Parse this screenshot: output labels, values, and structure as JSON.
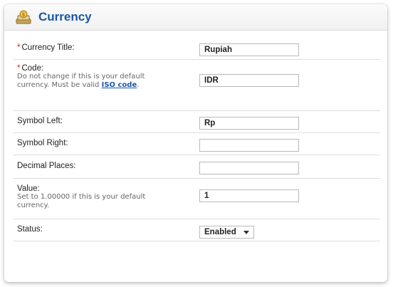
{
  "header": {
    "title": "Currency",
    "icon": "currency-icon"
  },
  "form": {
    "currency_title": {
      "label": "Currency Title:",
      "required_mark": "*",
      "value": "Rupiah"
    },
    "code": {
      "label": "Code:",
      "required_mark": "*",
      "help": "Do not change if this is your default currency. Must be valid",
      "help_link": "ISO code",
      "help_suffix": ".",
      "value": "IDR"
    },
    "symbol_left": {
      "label": "Symbol Left:",
      "value": "Rp"
    },
    "symbol_right": {
      "label": "Symbol Right:",
      "value": ""
    },
    "decimal_places": {
      "label": "Decimal Places:",
      "value": ""
    },
    "value": {
      "label": "Value:",
      "help": "Set to 1.00000 if this is your default currency.",
      "value": "1"
    },
    "status": {
      "label": "Status:",
      "selected": "Enabled"
    }
  },
  "colors": {
    "title": "#1b57a6",
    "required": "#e0151d"
  }
}
